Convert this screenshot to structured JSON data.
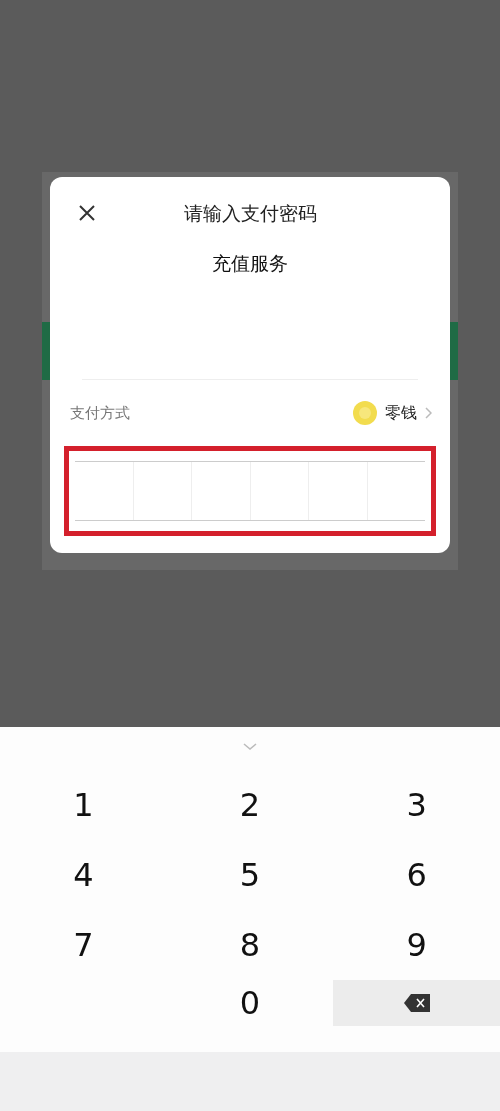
{
  "dialog": {
    "title": "请输入支付密码",
    "merchant": "充值服务",
    "payment_method": {
      "label": "支付方式",
      "value": "零钱"
    },
    "password_cells": [
      {
        "filled": false
      },
      {
        "filled": false
      },
      {
        "filled": false
      },
      {
        "filled": false
      },
      {
        "filled": false
      },
      {
        "filled": false
      }
    ],
    "highlighted": true
  },
  "keypad": {
    "keys": [
      {
        "kind": "digit",
        "label": "1"
      },
      {
        "kind": "digit",
        "label": "2"
      },
      {
        "kind": "digit",
        "label": "3"
      },
      {
        "kind": "digit",
        "label": "4"
      },
      {
        "kind": "digit",
        "label": "5"
      },
      {
        "kind": "digit",
        "label": "6"
      },
      {
        "kind": "digit",
        "label": "7"
      },
      {
        "kind": "digit",
        "label": "8"
      },
      {
        "kind": "digit",
        "label": "9"
      },
      {
        "kind": "blank"
      },
      {
        "kind": "digit",
        "label": "0"
      },
      {
        "kind": "delete"
      }
    ]
  }
}
